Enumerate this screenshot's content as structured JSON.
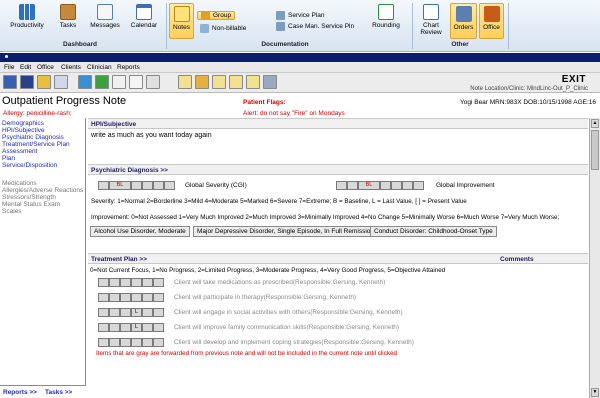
{
  "ribbon": {
    "productivity": "Productivity",
    "tasks": "Tasks",
    "messages": "Messages",
    "calendar": "Calendar",
    "dashboard_group": "Dashboard",
    "notes": "Notes",
    "group": "Group",
    "nonbillable": "Non-billable",
    "service_plan": "Service Plan",
    "case_man": "Case Man. Service Pln",
    "rounding": "Rounding",
    "documentation_group": "Documentation",
    "chart_review_1": "Chart",
    "chart_review_2": "Review",
    "orders": "Orders",
    "office": "Office",
    "other_group": "Other"
  },
  "menu": [
    "File",
    "Edit",
    "Office",
    "Clients",
    "Clinician",
    "Reports"
  ],
  "header": {
    "exit": "EXIT",
    "note_location": "Note Location/Clinic: MindLinc-Out_P_Clinic",
    "title": "Outpatient Progress Note",
    "allergy": "Allergy: penicilline-rash;",
    "patient_flags": "Patient Flags:",
    "alert": "Alert: do not say \"Fire\"  on Mondays",
    "patient": "Yogi Bear MRN:983X DOB:10/15/1998 AGE:16"
  },
  "nav": {
    "links": [
      "Demographics",
      "HPI/Subjective",
      "Psychiatric Diagnosis",
      "Treatment/Service Plan",
      "Assessment",
      "Plan",
      "Service/Disposition"
    ],
    "gray_links": [
      "Medications",
      "Allergies/Adverse Reactions",
      "Stressors/Strength",
      "Mental Status Exam",
      "Scales"
    ],
    "reports": "Reports >>",
    "tasks": "Tasks >>"
  },
  "hpi": {
    "heading": "HPI/Subjective",
    "text": "write as much as you want today again"
  },
  "diagnosis": {
    "heading": "Psychiatric Diagnosis >>",
    "bl": "BL",
    "global_severity": "Global Severity (CGI)",
    "global_improvement": "Global Improvement",
    "severity_legend": "Severity: 1=Normal 2=Borderline 3=Mild 4=Moderate 5=Marked 6=Severe 7=Extreme;  B = Baseline, L = Last Value, [ ] = Present Value",
    "improvement_legend": "Improvement: 0=Not Assessed 1=Very Much Improved 2=Much Improved 3=Minimally Improved 4=No Change 5=Minimally Worse 6=Much Worse 7=Very Much Worse;",
    "tabs": [
      "Alcohol Use Disorder, Moderate",
      "Major Depressive Disorder, Single Episode, In Full Remission",
      "Conduct Disorder: Childhood-Onset Type"
    ]
  },
  "treatment": {
    "heading": "Treatment Plan >>",
    "comments": "Comments",
    "scale": "0=Not Current Focus, 1=No Progress, 2=Limited Progress, 3=Moderate Progress, 4=Very Good Progress, 5=Objective Attained",
    "goals": [
      "Client will take medications as prescribed(Responsible:Gersing, Kenneth)",
      "Client will participate in therapy(Responsible:Gersing, Kenneth)",
      "Client will engage in social activities with others(Responsible:Gersing, Kenneth)",
      "Client will improve family communication skills(Responsible:Gersing, Kenneth)",
      "Client will develop and implement coping strategies(Responsible:Gersing, Kenneth)"
    ],
    "goal_marks": [
      "",
      "",
      "L",
      "L",
      ""
    ],
    "footnote": "Items that are gray are forwarded from previous note and will not be included in the current note until clicked"
  },
  "colors": {
    "accent": "#0a1e6e",
    "alert": "#d00000",
    "link": "#1e2bb8"
  }
}
